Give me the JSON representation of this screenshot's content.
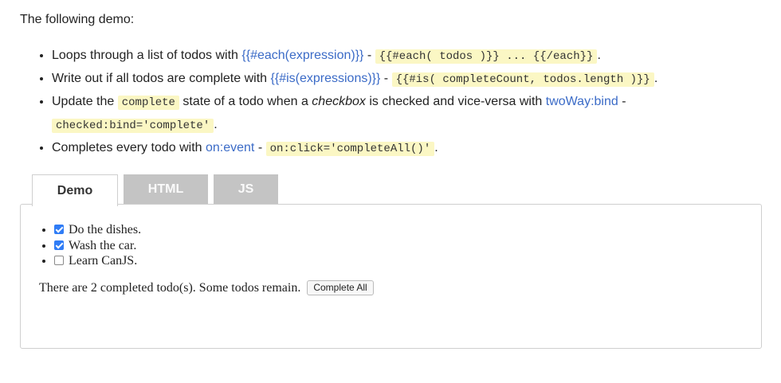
{
  "intro": "The following demo:",
  "features": [
    {
      "t1": "Loops through a list of todos with ",
      "link": "{{#each(expression)}}",
      "sep": " - ",
      "code1": "{{#each( todos )}} ... {{/each}}",
      "end": "."
    },
    {
      "t1": "Write out if all todos are complete with ",
      "link": "{{#is(expressions)}}",
      "sep": " - ",
      "code1": "{{#is( completeCount, todos.length )}}",
      "end": "."
    },
    {
      "t1": "Update the ",
      "code_state": "complete",
      "t2": " state of a todo when a ",
      "em": "checkbox",
      "t3": " is checked and vice-versa with ",
      "link": "twoWay:bind",
      "sep": " - ",
      "code1": "checked:bind='complete'",
      "end": "."
    },
    {
      "t1": "Completes every todo with ",
      "link": "on:event",
      "sep": " - ",
      "code1": "on:click='completeAll()'",
      "end": "."
    }
  ],
  "tabs": [
    "Demo",
    "HTML",
    "JS"
  ],
  "todos": [
    {
      "label": "Do the dishes.",
      "complete": true
    },
    {
      "label": "Wash the car.",
      "complete": true
    },
    {
      "label": "Learn CanJS.",
      "complete": false
    }
  ],
  "status_text": "There are 2 completed todo(s). Some todos remain.",
  "complete_all_label": "Complete All"
}
